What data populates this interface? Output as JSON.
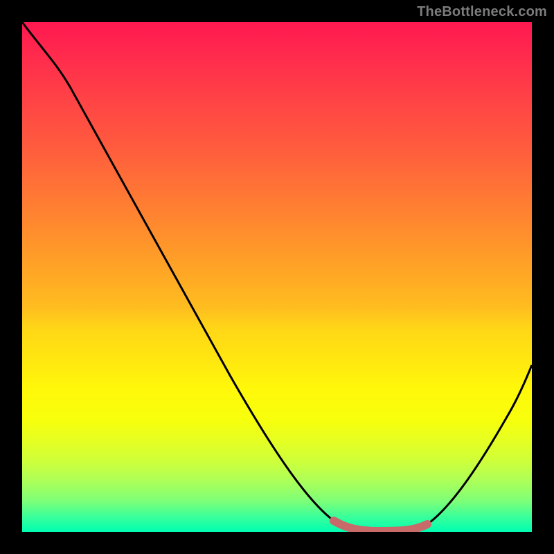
{
  "watermark": "TheBottleneck.com",
  "chart_data": {
    "type": "line",
    "title": "",
    "xlabel": "",
    "ylabel": "",
    "xlim": [
      0,
      100
    ],
    "ylim": [
      0,
      100
    ],
    "series": [
      {
        "name": "bottleneck-curve",
        "x": [
          0,
          6,
          12,
          18,
          24,
          30,
          36,
          42,
          48,
          54,
          58,
          62,
          66,
          70,
          74,
          78,
          82,
          86,
          90,
          94,
          100
        ],
        "values": [
          100,
          94,
          86,
          77,
          68,
          59,
          50,
          41,
          32,
          23,
          16,
          10,
          5,
          2,
          0.5,
          0.5,
          2,
          6,
          12,
          20,
          33
        ]
      }
    ],
    "highlight": {
      "name": "optimal-range",
      "x_start": 62,
      "x_end": 80,
      "color": "#c96a6a"
    },
    "background_gradient_stops": [
      {
        "pos": 0,
        "color": "#ff1850"
      },
      {
        "pos": 50,
        "color": "#ffb020"
      },
      {
        "pos": 75,
        "color": "#fff80a"
      },
      {
        "pos": 100,
        "color": "#00ffb2"
      }
    ]
  }
}
